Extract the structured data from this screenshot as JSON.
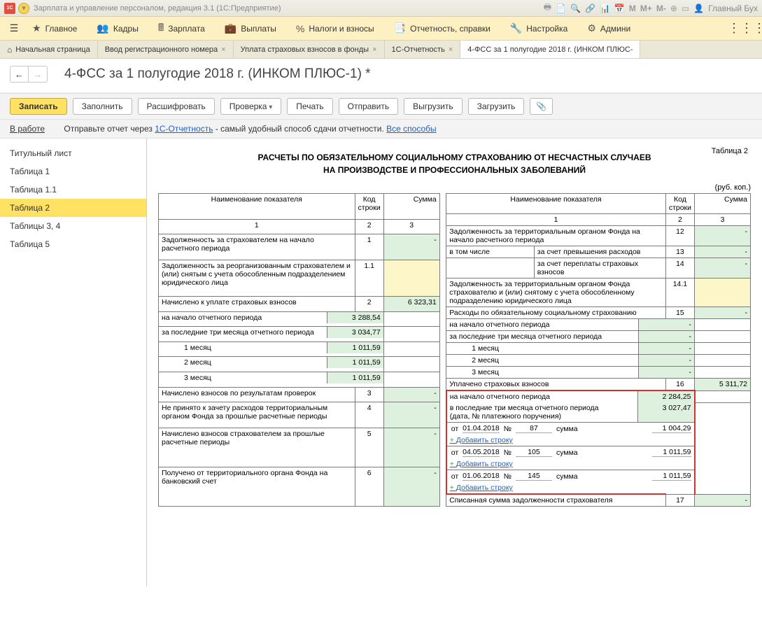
{
  "titlebar": {
    "app_title": "Зарплата и управление персоналом, редакция 3.1  (1С:Предприятие)",
    "user": "Главный Бух"
  },
  "menu": {
    "items": [
      "Главное",
      "Кадры",
      "Зарплата",
      "Выплаты",
      "Налоги и взносы",
      "Отчетность, справки",
      "Настройка",
      "Админи"
    ]
  },
  "tabs": {
    "items": [
      {
        "label": "Начальная страница",
        "home": true,
        "closable": false
      },
      {
        "label": "Ввод регистрационного номера",
        "closable": true
      },
      {
        "label": "Уплата страховых взносов в фонды",
        "closable": true
      },
      {
        "label": "1С-Отчетность",
        "closable": true
      },
      {
        "label": "4-ФСС за 1 полугодие 2018 г. (ИНКОМ ПЛЮС-",
        "closable": false,
        "active": true
      }
    ]
  },
  "header": {
    "title": "4-ФСС за 1 полугодие 2018 г. (ИНКОМ ПЛЮС-1) *"
  },
  "cmd": {
    "write": "Записать",
    "fill": "Заполнить",
    "decode": "Расшифровать",
    "check": "Проверка",
    "print": "Печать",
    "send": "Отправить",
    "export": "Выгрузить",
    "import": "Загрузить"
  },
  "status": {
    "label": "В работе",
    "text1": "Отправьте отчет через ",
    "link1": "1С-Отчетность",
    "text2": " - самый удобный способ сдачи отчетности. ",
    "link2": "Все способы"
  },
  "sidebar": {
    "items": [
      "Титульный лист",
      "Таблица 1",
      "Таблица 1.1",
      "Таблица 2",
      "Таблицы 3, 4",
      "Таблица 5"
    ],
    "active": 3
  },
  "report": {
    "tablelabel": "Таблица 2",
    "title1": "РАСЧЕТЫ ПО ОБЯЗАТЕЛЬНОМУ СОЦИАЛЬНОМУ СТРАХОВАНИЮ ОТ НЕСЧАСТНЫХ СЛУЧАЕВ",
    "title2": "НА ПРОИЗВОДСТВЕ И ПРОФЕССИОНАЛЬНЫХ ЗАБОЛЕВАНИЙ",
    "unit": "(руб. коп.)",
    "hdr": {
      "name": "Наименование показателя",
      "code": "Код строки",
      "sum": "Сумма"
    },
    "left": {
      "r1": {
        "name": "Задолженность за страхователем на начало расчетного периода",
        "code": "1",
        "val": "-"
      },
      "r11": {
        "name": "Задолженность за реорганизованным страхователем и (или) снятым с учета обособленным подразделением юридического лица",
        "code": "1.1",
        "val": ""
      },
      "r2": {
        "name": "Начислено к уплате страховых взносов",
        "code": "2",
        "val": "6 323,31"
      },
      "r2a": {
        "name": "на начало отчетного периода",
        "val": "3 288,54"
      },
      "r2b": {
        "name": "за последние три месяца отчетного периода",
        "val": "3 034,77"
      },
      "m1": {
        "name": "1 месяц",
        "val": "1 011,59"
      },
      "m2": {
        "name": "2 месяц",
        "val": "1 011,59"
      },
      "m3": {
        "name": "3 месяц",
        "val": "1 011,59"
      },
      "r3": {
        "name": "Начислено взносов по результатам проверок",
        "code": "3",
        "val": "-"
      },
      "r4": {
        "name": "Не принято к зачету расходов территориальным органом Фонда за прошлые расчетные периоды",
        "code": "4",
        "val": "-"
      },
      "r5": {
        "name": "Начислено взносов страхователем за прошлые расчетные периоды",
        "code": "5",
        "val": "-"
      },
      "r6": {
        "name": "Получено от территориального органа Фонда на банковский счет",
        "code": "6",
        "val": "-"
      }
    },
    "right": {
      "r12": {
        "name": "Задолженность за территориальным органом Фонда на начало расчетного периода",
        "code": "12",
        "val": "-"
      },
      "incl": "в том числе",
      "r13": {
        "name": "за счет превышения расходов",
        "code": "13",
        "val": "-"
      },
      "r14": {
        "name": "за счет переплаты страховых взносов",
        "code": "14",
        "val": "-"
      },
      "r141": {
        "name": "Задолженность за территориальным органом Фонда страхователю и (или) снятому с учета обособленному подразделению юридического лица",
        "code": "14.1",
        "val": ""
      },
      "r15": {
        "name": "Расходы по обязательному социальному страхованию",
        "code": "15",
        "val": "-"
      },
      "r15a": {
        "name": "на начало отчетного периода",
        "val": "-"
      },
      "r15b": {
        "name": "за последние три месяца отчетного периода",
        "val": "-"
      },
      "m1": {
        "name": "1 месяц",
        "val": "-"
      },
      "m2": {
        "name": "2 месяц",
        "val": "-"
      },
      "m3": {
        "name": "3 месяц",
        "val": "-"
      },
      "r16": {
        "name": "Уплачено страховых взносов",
        "code": "16",
        "val": "5 311,72"
      },
      "r16a": {
        "name": "на начало отчетного периода",
        "val": "2 284,25"
      },
      "r16b": {
        "name": "в последние три месяца отчетного периода\n(дата, № платежного поручения)",
        "val": "3 027,47"
      },
      "pay1": {
        "date": "01.04.2018",
        "num": "87",
        "amt": "1 004,29"
      },
      "pay2": {
        "date": "04.05.2018",
        "num": "105",
        "amt": "1 011,59"
      },
      "pay3": {
        "date": "01.06.2018",
        "num": "145",
        "amt": "1 011,59"
      },
      "addrow": "Добавить строку",
      "paylabels": {
        "from": "от",
        "num": "№",
        "sum": "сумма"
      },
      "r17": {
        "name": "Списанная сумма задолженности страхователя",
        "code": "17",
        "val": "-"
      }
    }
  }
}
